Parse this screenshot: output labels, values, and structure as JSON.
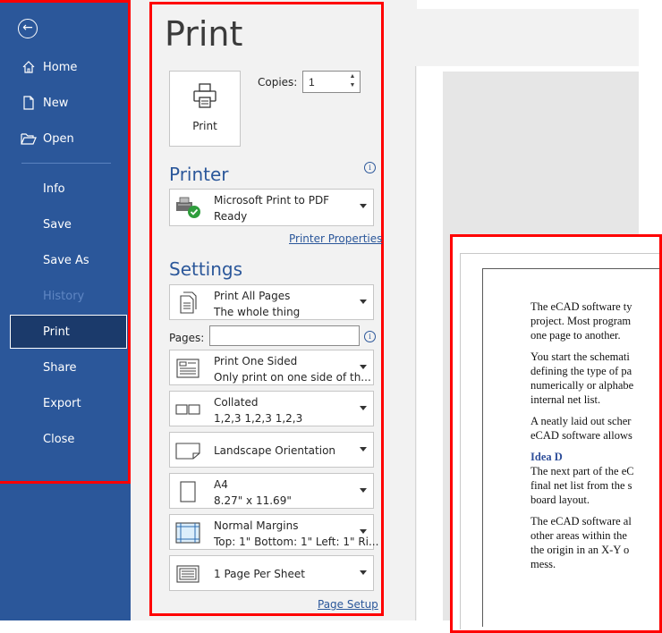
{
  "nav": {
    "back_icon": "back-arrow-icon",
    "items": [
      {
        "label": "Home",
        "icon": "home-icon"
      },
      {
        "label": "New",
        "icon": "new-document-icon"
      },
      {
        "label": "Open",
        "icon": "open-folder-icon"
      },
      {
        "label": "Info"
      },
      {
        "label": "Save"
      },
      {
        "label": "Save As"
      },
      {
        "label": "History",
        "disabled": true
      },
      {
        "label": "Print",
        "selected": true
      },
      {
        "label": "Share"
      },
      {
        "label": "Export"
      },
      {
        "label": "Close"
      }
    ]
  },
  "print": {
    "title": "Print",
    "print_button_label": "Print",
    "copies_label": "Copies:",
    "copies_value": "1"
  },
  "printer": {
    "heading": "Printer",
    "name": "Microsoft Print to PDF",
    "status": "Ready",
    "properties_link": "Printer Properties"
  },
  "settings": {
    "heading": "Settings",
    "pages_label": "Pages:",
    "pages_value": "",
    "dropdowns": [
      {
        "line1": "Print All Pages",
        "line2": "The whole thing"
      },
      {
        "line1": "Print One Sided",
        "line2": "Only print on one side of th..."
      },
      {
        "line1": "Collated",
        "line2": "1,2,3   1,2,3   1,2,3"
      },
      {
        "line1": "Landscape Orientation",
        "line2": ""
      },
      {
        "line1": "A4",
        "line2": "8.27\" x 11.69\""
      },
      {
        "line1": "Normal Margins",
        "line2": "Top: 1\" Bottom: 1\" Left: 1\" Ri..."
      },
      {
        "line1": "1 Page Per Sheet",
        "line2": ""
      }
    ],
    "page_setup_link": "Page Setup"
  },
  "preview": {
    "paragraphs": [
      [
        "The eCAD software ty",
        "project. Most program",
        "one page to another."
      ],
      [
        "You start the schemati",
        "defining the type of pa",
        "numerically or alphabe",
        "internal net list."
      ],
      [
        "A neatly laid out scher",
        "eCAD software allows"
      ]
    ],
    "heading": "Idea D",
    "paragraphs2": [
      [
        "The next part of the eC",
        "final net list from the s",
        "board layout."
      ],
      [
        "The eCAD software al",
        "other areas within the",
        "the origin in an X-Y o",
        "mess."
      ]
    ]
  },
  "colors": {
    "nav_bg": "#2b579a",
    "selected_bg": "#1b3a6b",
    "accent": "#2b579a",
    "highlight_outline": "#ff0000"
  }
}
